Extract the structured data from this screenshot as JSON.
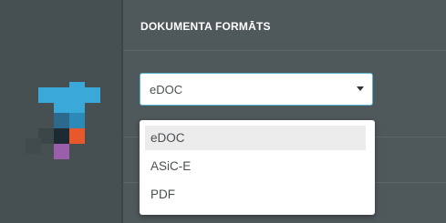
{
  "section": {
    "title": "DOKUMENTA FORMĀTS"
  },
  "format_select": {
    "value": "eDOC",
    "options": [
      "eDOC",
      "ASiC-E",
      "PDF"
    ],
    "selected_index": 0
  },
  "logo": {
    "colors": [
      "#3aa8d8",
      "#2b6a8c",
      "#1e2a33",
      "#e8582a",
      "#9b5ea8",
      "#3c4548"
    ]
  }
}
